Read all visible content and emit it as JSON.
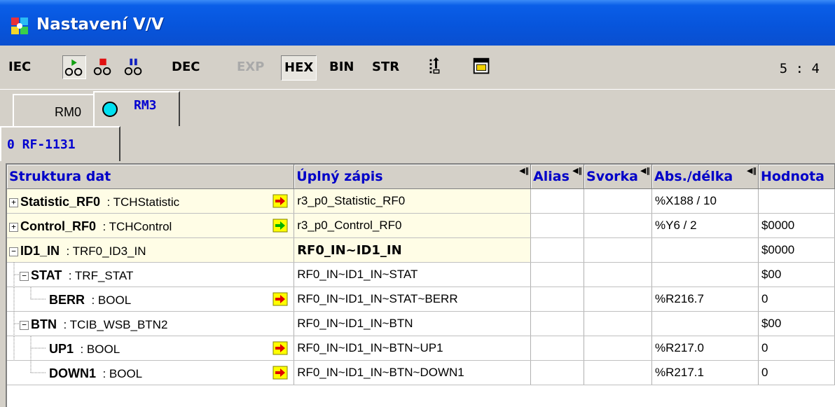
{
  "window": {
    "title": "Nastavení V/V",
    "icon": "puzzle-app-icon"
  },
  "toolbar": {
    "iec": "IEC",
    "dec": "DEC",
    "exp": "EXP",
    "hex": "HEX",
    "bin": "BIN",
    "str": "STR",
    "ratio": "5 : 4"
  },
  "tabs": {
    "rm0": "RM0",
    "rm3": "RM3",
    "rf": "0 RF-1131"
  },
  "columns": [
    "Struktura dat",
    "Úplný zápis",
    "Alias",
    "Svorka",
    "Abs./délka",
    "Hodnota"
  ],
  "rows": [
    {
      "name": "Statistic_RF0",
      "type": ": TCHStatistic",
      "full": "r3_p0_Statistic_RF0",
      "alias": "",
      "svorka": "",
      "abs": "%X188 / 10",
      "value": ""
    },
    {
      "name": "Control_RF0",
      "type": ": TCHControl",
      "full": "r3_p0_Control_RF0",
      "alias": "",
      "svorka": "",
      "abs": "%Y6 / 2",
      "value": "$0000"
    },
    {
      "name": "ID1_IN",
      "type": ": TRF0_ID3_IN",
      "full": "RF0_IN~ID1_IN",
      "alias": "",
      "svorka": "",
      "abs": "",
      "value": "$0000"
    },
    {
      "name": "STAT",
      "type": ": TRF_STAT",
      "full": "RF0_IN~ID1_IN~STAT",
      "alias": "",
      "svorka": "",
      "abs": "",
      "value": "$00"
    },
    {
      "name": "BERR",
      "type": ": BOOL",
      "full": "RF0_IN~ID1_IN~STAT~BERR",
      "alias": "",
      "svorka": "",
      "abs": "%R216.7",
      "value": "0"
    },
    {
      "name": "BTN",
      "type": ": TCIB_WSB_BTN2",
      "full": "RF0_IN~ID1_IN~BTN",
      "alias": "",
      "svorka": "",
      "abs": "",
      "value": "$00"
    },
    {
      "name": "UP1",
      "type": ": BOOL",
      "full": "RF0_IN~ID1_IN~BTN~UP1",
      "alias": "",
      "svorka": "",
      "abs": "%R217.0",
      "value": "0"
    },
    {
      "name": "DOWN1",
      "type": ": BOOL",
      "full": "RF0_IN~ID1_IN~BTN~DOWN1",
      "alias": "",
      "svorka": "",
      "abs": "%R217.1",
      "value": "0"
    }
  ],
  "colors": {
    "titlebar": "#0755dc",
    "header_text": "#0000c8",
    "row_bg": "#fffde6",
    "arrow_red": "#e00000",
    "arrow_green": "#00a000",
    "badge_yellow": "#ffff00"
  }
}
